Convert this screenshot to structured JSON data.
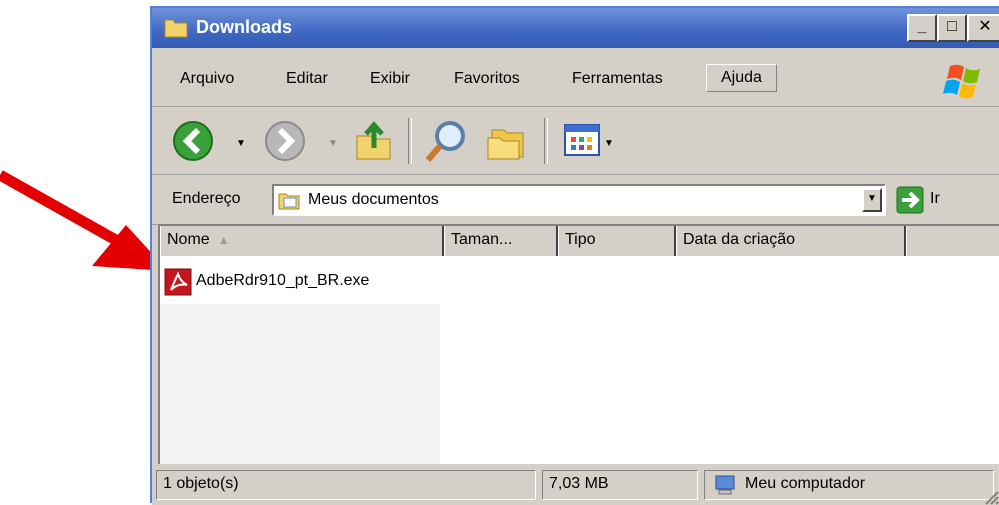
{
  "window": {
    "title": "Downloads",
    "controls": {
      "minimize": "_",
      "maximize": "□",
      "close": "✕"
    }
  },
  "menu": {
    "items": [
      {
        "label": "Arquivo"
      },
      {
        "label": "Editar"
      },
      {
        "label": "Exibir"
      },
      {
        "label": "Favoritos"
      },
      {
        "label": "Ferramentas"
      },
      {
        "label": "Ajuda"
      }
    ]
  },
  "address": {
    "label": "Endereço",
    "value": "Meus documentos",
    "go_label": "Ir"
  },
  "list": {
    "columns": [
      {
        "label": "Nome",
        "sorted": true
      },
      {
        "label": "Taman..."
      },
      {
        "label": "Tipo"
      },
      {
        "label": "Data da criação"
      },
      {
        "label": ""
      }
    ],
    "files": [
      {
        "name": "AdbeRdr910_pt_BR.exe",
        "icon": "adobe-reader-icon"
      }
    ]
  },
  "status": {
    "objects": "1 objeto(s)",
    "size": "7,03 MB",
    "location": "Meu computador"
  },
  "colors": {
    "titlebar": "#3f68c4",
    "window_face": "#d4d0c8",
    "arrow": "#e30000",
    "pdf_red": "#c4161c"
  }
}
